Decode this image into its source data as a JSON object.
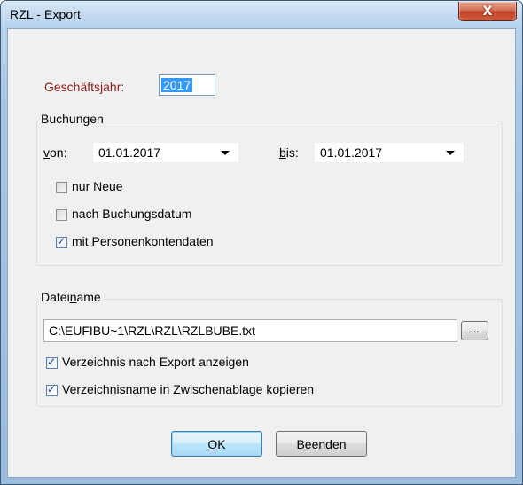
{
  "window": {
    "title": "RZL - Export",
    "close_glyph": "X"
  },
  "geschaeftsjahr": {
    "label": "Geschäftsjahr:",
    "value": "2017"
  },
  "buchungen": {
    "legend": "Buchungen",
    "von_prefix": "v",
    "von_rest": "on:",
    "von_value": "01.01.2017",
    "bis_prefix": "b",
    "bis_rest": "is:",
    "bis_value": "01.01.2017",
    "checkboxes": [
      {
        "label": "nur Neue",
        "checked": false
      },
      {
        "label": "nach Buchungsdatum",
        "checked": false
      },
      {
        "label": "mit Personenkontendaten",
        "checked": true
      }
    ]
  },
  "dateiname": {
    "legend_before": "Datei",
    "legend_accel": "n",
    "legend_after": "ame",
    "path": "C:\\EUFIBU~1\\RZL\\RZL\\RZLBUBE.txt",
    "browse_label": "...",
    "checkboxes": [
      {
        "label": "Verzeichnis nach Export anzeigen",
        "checked": true
      },
      {
        "label": "Verzeichnisname in Zwischenablage kopieren",
        "checked": true
      }
    ]
  },
  "buttons": {
    "ok_accel": "O",
    "ok_rest": "K",
    "beenden_before": "B",
    "beenden_accel": "e",
    "beenden_after": "enden"
  },
  "colors": {
    "label_red": "#8b1a1a",
    "selection_blue": "#3399ff",
    "check_color": "#283c8a"
  }
}
